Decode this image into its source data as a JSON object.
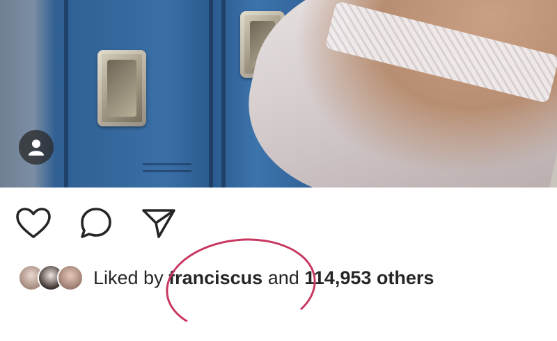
{
  "post": {
    "photo_alt": "",
    "tag_icon": "user-tag-icon"
  },
  "actions": {
    "like_icon": "heart-icon",
    "comment_icon": "comment-icon",
    "share_icon": "send-icon"
  },
  "likes": {
    "prefix": "Liked by",
    "user": "franciscus",
    "connector": "and",
    "count_text": "114,953 others"
  },
  "caption": {
    "user": "",
    "text": ""
  },
  "colors": {
    "text": "#262626",
    "annotation_circle": "#c8375f"
  }
}
